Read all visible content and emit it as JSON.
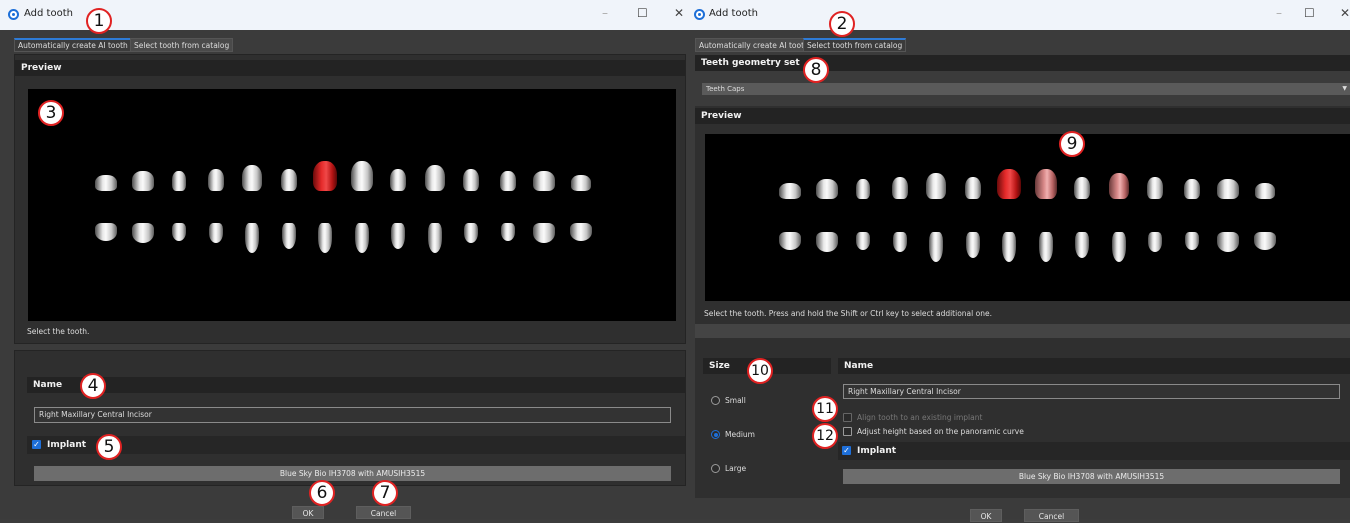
{
  "left_window": {
    "title": "Add tooth",
    "tabs": [
      "Automatically create AI tooth",
      "Select tooth from catalog"
    ],
    "preview_header": "Preview",
    "preview_hint": "Select the tooth.",
    "name_header": "Name",
    "name_value": "Right Maxillary Central Incisor",
    "implant_label": "Implant",
    "implant_checked": true,
    "implant_value": "Blue Sky Bio IH3708 with AMUSIH3515",
    "ok_label": "OK",
    "cancel_label": "Cancel",
    "minimize_glyph": "–",
    "maximize_glyph": "☐",
    "close_glyph": "✕"
  },
  "right_window": {
    "title": "Add tooth",
    "tabs": [
      "Automatically create AI tooth",
      "Select tooth from catalog"
    ],
    "geometry_header": "Teeth geometry set",
    "geometry_value": "Teeth Caps",
    "preview_header": "Preview",
    "preview_hint": "Select the tooth. Press and hold the Shift or Ctrl key to select additional one.",
    "size_header": "Size",
    "size_options": [
      "Small",
      "Medium",
      "Large"
    ],
    "size_selected": "Medium",
    "name_header": "Name",
    "name_value": "Right Maxillary Central Incisor",
    "align_label": "Align tooth to an existing implant",
    "adjust_label": "Adjust height based on the panoramic curve",
    "implant_label": "Implant",
    "implant_checked": true,
    "implant_value": "Blue Sky Bio IH3708 with AMUSIH3515",
    "ok_label": "OK",
    "cancel_label": "Cancel",
    "minimize_glyph": "–",
    "maximize_glyph": "☐",
    "close_glyph": "✕"
  },
  "callouts": [
    "1",
    "2",
    "3",
    "4",
    "5",
    "6",
    "7",
    "8",
    "9",
    "10",
    "11",
    "12"
  ],
  "colors": {
    "accent": "#1e6fd9",
    "selected_tooth": "#e52a2a",
    "secondary_selected_tooth": "#e8a0a0",
    "callout_border": "#e02222"
  }
}
